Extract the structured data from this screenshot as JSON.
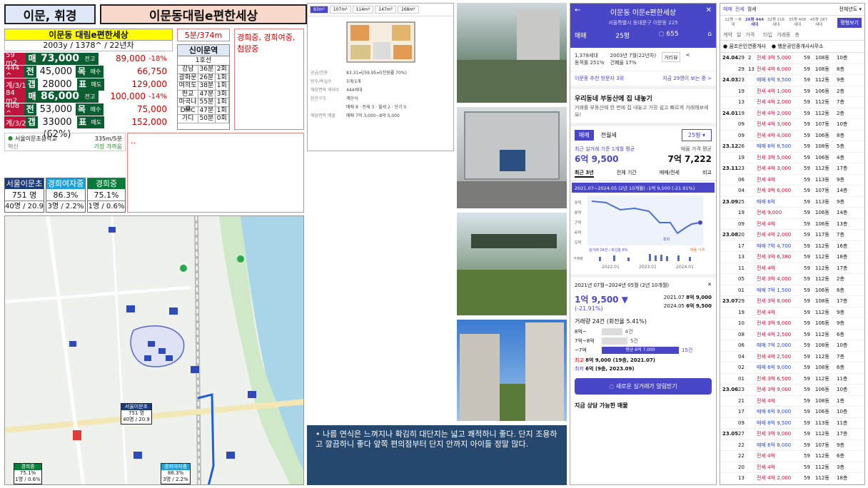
{
  "header": {
    "area": "이문, 휘경",
    "complex": "이문동대림e편한세상"
  },
  "summary": {
    "name": "이문동 대림e편한세상",
    "meta": "2003y / 1378^ / 22년차",
    "walk": "5분/374m",
    "notes": "경희중, 경희여중, 첨량중"
  },
  "units": [
    {
      "size": "59 m2",
      "mae": "매",
      "mae_v": "73,000",
      "tag": "전고(대비)",
      "high": "89,000",
      "pct": "-18%",
      "c1b": "444 ^",
      "jeon": "전",
      "jeon_v": "45,000",
      "mok": "목",
      "mok_l": "매수",
      "mok_v": "66,750",
      "c1c": "계/3/1",
      "gap": "갭",
      "gap_v": "28000 (62%)",
      "pyo": "표",
      "pyo_l": "매도",
      "pyo_v": "129,000"
    },
    {
      "size": "84 m2",
      "mae": "매",
      "mae_v": "86,000",
      "tag": "전고(대비)",
      "high": "100,000",
      "pct": "-14%",
      "c1b": "408 ^",
      "jeon": "전",
      "jeon_v": "53,000",
      "mok": "목",
      "mok_l": "매수",
      "mok_v": "75,000",
      "c1c": "계/3/2",
      "gap": "갭",
      "gap_v": "33000 (62%)",
      "pyo": "표",
      "pyo_l": "매도",
      "pyo_v": "152,000"
    }
  ],
  "subway": {
    "title": "신이문역",
    "line": "1호선",
    "rows": [
      [
        "강남",
        "36분",
        "2회"
      ],
      [
        "광화문",
        "26분",
        "1회"
      ],
      [
        "여의도",
        "38분",
        "1회"
      ],
      [
        "판교",
        "47분",
        "3회"
      ],
      [
        "마곡나루",
        "55분",
        "1회"
      ],
      [
        "DMC",
        "47분",
        "1회"
      ],
      [
        "가디",
        "50분",
        "0회"
      ]
    ]
  },
  "school": {
    "name": "서울이문초등학교",
    "dist": "335m/5분",
    "sub": "혁신",
    "sub2": "가장 가까움"
  },
  "placeholder": "..",
  "stats": [
    {
      "h": "서울이문초",
      "v": "751 명",
      "s": "40명 / 20.9",
      "color": "#1a3a78"
    },
    {
      "h": "경희여자중",
      "v": "86.3%",
      "s": "3명 / 2.2%",
      "color": "#1ea0d8"
    },
    {
      "h": "경희중",
      "v": "75.1%",
      "s": "1명 / 0.6%",
      "color": "#0a7a3a"
    }
  ],
  "map": {
    "label1": "서울이문초",
    "label1b": "751 명",
    "label1c": "40명 / 20.9",
    "label2": "경희중",
    "label2b": "75.1%",
    "label2c": "1명 / 0.6%",
    "label3": "경희여자중",
    "label3b": "86.3%",
    "label3c": "3명 / 2.2%"
  },
  "floorplan": {
    "tabs": [
      "83m²",
      "107m²",
      "114m²",
      "147m²",
      "168m²"
    ],
    "info": [
      [
        "공급/전용",
        "83.31㎡/59.95㎡(전용률 70%)"
      ],
      [
        "방수/욕실수",
        "3개/1개"
      ],
      [
        "해당면적 세대수",
        "444세대"
      ],
      [
        "현관구조",
        "계단식"
      ],
      [
        "",
        "매매 8 · 전세 3 · 월세 2 · 단기 0"
      ],
      [
        "해당면적 매물",
        "매매 7억 3,000~8억 5,000"
      ]
    ]
  },
  "desc": "나름 연식은 느껴지나 확김히 대단지는 넓고 쾌적하니 좋다. 단지 조용하고 깔끔하니 좋다 앞쪽 편의점부터 단지 안까지 아이들 정말 많다.",
  "app": {
    "title": "이문동 이문e편한세상",
    "addr": "서울특별시 동대문구 이문동 225",
    "nav": [
      "매매",
      "25평",
      "655"
    ],
    "info1": "1,378세대",
    "info2": "동적률 251%",
    "info3": "2003년 7월(22년차)",
    "info4": "건폐율 17%",
    "btn_dist": "거리뷰",
    "visit": "이문동 추천 방문자 3위",
    "visit_r": "지금 29명이 보는 중 >",
    "promo_t": "우리동네 부동산에 집 내놓기",
    "promo_s": "거래를 부동산에 한 번에 집 내놓고 가장 쉽고 빠르게 거래해보세요!",
    "tab_a": "매매",
    "tab_b": "전월세",
    "sel": "25평",
    "price_l": "최근 실거래 기준 1개월 평균",
    "price": "6억 9,500",
    "price_r_l": "매물 가격 평균",
    "price_r": "7억 7,222",
    "ctabs": [
      "최근 3년",
      "전체 기간",
      "매매/전세",
      "비교"
    ],
    "range": "2021.07~2024.05 (2년 10개월) -1억 9,500 (-21.91%)",
    "chart": {
      "y_ticks": [
        "9억",
        "8억",
        "7억",
        "6억",
        "5억"
      ],
      "x_ticks": [
        "2022.01",
        "2023.01",
        "2024.01"
      ],
      "legend": "실거래 26건 / 최신층 6%",
      "vol": "거래량",
      "max": "매물 가격",
      "min": "최저"
    },
    "drop_range": "2021년 07월~2024년 05월 (2년 10개월)",
    "drop": "1억 9,500 ▼",
    "drop_pct": "(-21.91%)",
    "hi_d": "2021.07",
    "hi_v": "8억 9,000",
    "lo_d": "2024.05",
    "lo_v": "6억 9,500",
    "vol_t": "거래량 24건 (회전율 5.41%)",
    "bars": [
      [
        "8억~",
        "4건"
      ],
      [
        "7억~8억",
        "5건"
      ],
      [
        "~7억",
        "15건"
      ]
    ],
    "bar_label": "평균 6억 7,000",
    "hi": "최고",
    "hi_full": "8억 9,000 (19층, 2021.07)",
    "lo": "최저",
    "lo_full": "6억 (9층, 2023.09)",
    "cta": "새로운 실거래가 알림받기",
    "bottom": "지금 상담 가능한 매물"
  },
  "list": {
    "tabs": [
      "매매",
      "전세",
      "월세"
    ],
    "sel": "전체년도",
    "ptabs": [
      "12평 ~세대",
      "26평 444세대",
      "32평 216세대",
      "35평 408세대",
      "45평 287세대"
    ],
    "btn": "평형보기",
    "cols": [
      "계약",
      "일",
      "가격",
      "",
      "타입",
      "거래동",
      "층"
    ],
    "agents": [
      "꿈조은인연중개사",
      "행운공인중개사사무소"
    ],
    "rows": [
      [
        "24.04",
        "29",
        "2",
        "전세 3억 5,000",
        "59",
        "108동",
        "10층"
      ],
      [
        "",
        "29",
        "13",
        "전세 4억 6,000",
        "59",
        "108동",
        "8층"
      ],
      [
        "24.03",
        "23",
        "",
        "매매 6억 9,500",
        "59",
        "112동",
        "9층"
      ],
      [
        "",
        "19",
        "",
        "전세 4억 1,000",
        "59",
        "106동",
        "2층"
      ],
      [
        "",
        "13",
        "",
        "전세 4억 2,000",
        "59",
        "112동",
        "7층"
      ],
      [
        "24.01",
        "19",
        "",
        "전세 4억 2,000",
        "59",
        "112동",
        "2층"
      ],
      [
        "",
        "09",
        "",
        "전세 4억 3,000",
        "59",
        "107동",
        "10층"
      ],
      [
        "",
        "09",
        "",
        "전세 4억 4,000",
        "59",
        "106동",
        "8층"
      ],
      [
        "23.12",
        "26",
        "",
        "매매 6억 8,500",
        "59",
        "108동",
        "5층"
      ],
      [
        "",
        "19",
        "",
        "전세 3억 5,000",
        "59",
        "106동",
        "4층"
      ],
      [
        "23.11",
        "23",
        "",
        "전세 4억 3,000",
        "59",
        "112동",
        "17층"
      ],
      [
        "",
        "06",
        "",
        "전세 4억",
        "59",
        "113동",
        "9층"
      ],
      [
        "",
        "04",
        "",
        "전세 3억 6,000",
        "59",
        "107동",
        "14층"
      ],
      [
        "23.09",
        "25",
        "",
        "매매 6억",
        "59",
        "113동",
        "9층"
      ],
      [
        "",
        "19",
        "",
        "전세 9,000",
        "59",
        "106동",
        "14층"
      ],
      [
        "",
        "09",
        "",
        "전세 4억",
        "59",
        "106동",
        "13층"
      ],
      [
        "23.08",
        "20",
        "",
        "전세 4억 2,000",
        "59",
        "117동",
        "7층"
      ],
      [
        "",
        "17",
        "",
        "매매 7억 4,700",
        "59",
        "112동",
        "16층"
      ],
      [
        "",
        "13",
        "",
        "전세 3억 6,380",
        "59",
        "112동",
        "18층"
      ],
      [
        "",
        "11",
        "",
        "전세 4억",
        "59",
        "112동",
        "17층"
      ],
      [
        "",
        "05",
        "",
        "전세 3억 4,000",
        "59",
        "112동",
        "2층"
      ],
      [
        "",
        "01",
        "",
        "매매 7억 1,500",
        "59",
        "106동",
        "6층"
      ],
      [
        "23.07",
        "29",
        "",
        "전세 3억 8,000",
        "59",
        "108동",
        "17층"
      ],
      [
        "",
        "19",
        "",
        "전세 4억",
        "59",
        "112동",
        "9층"
      ],
      [
        "",
        "10",
        "",
        "전세 3억 9,000",
        "59",
        "106동",
        "9층"
      ],
      [
        "",
        "08",
        "",
        "전세 4억 2,500",
        "59",
        "112동",
        "6층"
      ],
      [
        "",
        "06",
        "",
        "매매 7억 2,000",
        "59",
        "108동",
        "10층"
      ],
      [
        "",
        "04",
        "",
        "전세 4억 2,500",
        "59",
        "112동",
        "7층"
      ],
      [
        "",
        "02",
        "",
        "매매 6억 9,000",
        "59",
        "108동",
        "6층"
      ],
      [
        "",
        "01",
        "",
        "전세 3억 6,500",
        "59",
        "112동",
        "11층"
      ],
      [
        "23.06",
        "23",
        "",
        "전세 3억 9,000",
        "59",
        "106동",
        "10층"
      ],
      [
        "",
        "21",
        "",
        "전세 4억",
        "59",
        "108동",
        "1층"
      ],
      [
        "",
        "17",
        "",
        "매매 6억 9,000",
        "59",
        "106동",
        "10층"
      ],
      [
        "",
        "09",
        "",
        "매매 6억 9,500",
        "59",
        "113동",
        "11층"
      ],
      [
        "23.05",
        "27",
        "",
        "전세 3억 9,000",
        "59",
        "112동",
        "17층"
      ],
      [
        "",
        "22",
        "",
        "매매 6억 8,000",
        "59",
        "107동",
        "9층"
      ],
      [
        "",
        "22",
        "",
        "전세 4억",
        "59",
        "112동",
        "6층"
      ],
      [
        "",
        "20",
        "",
        "전세 4억",
        "59",
        "112동",
        "3층"
      ],
      [
        "",
        "13",
        "",
        "전세 4억 2,000",
        "59",
        "112동",
        "18층"
      ],
      [
        "",
        "07",
        "",
        "매매 7억",
        "59",
        "112동",
        "9층"
      ],
      [
        "",
        "02",
        "",
        "전세 3억 8,000",
        "59",
        "107동",
        "15층"
      ]
    ]
  }
}
